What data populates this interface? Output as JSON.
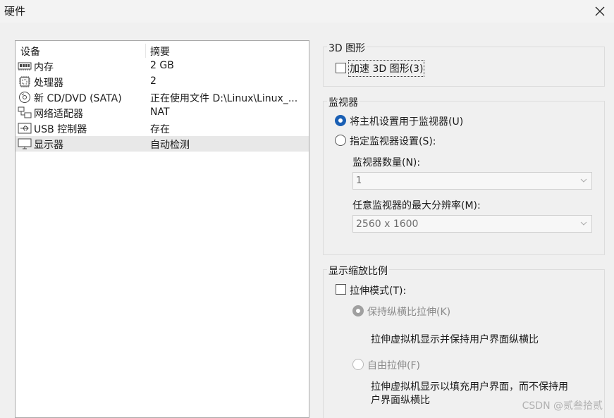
{
  "window": {
    "title": "硬件"
  },
  "device_list": {
    "headers": {
      "device": "设备",
      "summary": "摘要"
    },
    "rows": [
      {
        "name": "内存",
        "summary": "2 GB",
        "icon": "memory-icon"
      },
      {
        "name": "处理器",
        "summary": "2",
        "icon": "processor-icon"
      },
      {
        "name": "新 CD/DVD (SATA)",
        "summary": "正在使用文件 D:\\Linux\\Linux_...",
        "icon": "cd-dvd-icon"
      },
      {
        "name": "网络适配器",
        "summary": "NAT",
        "icon": "network-adapter-icon"
      },
      {
        "name": "USB 控制器",
        "summary": "存在",
        "icon": "usb-icon"
      },
      {
        "name": "显示器",
        "summary": "自动检测",
        "icon": "monitor-icon",
        "selected": true
      }
    ]
  },
  "graphics_3d": {
    "title": "3D 图形",
    "accelerate_label": "加速 3D 图形(3)",
    "accelerate_checked": false
  },
  "monitor": {
    "title": "监视器",
    "use_host_label": "将主机设置用于监视器(U)",
    "use_host_selected": true,
    "specify_label": "指定监视器设置(S):",
    "specify_selected": false,
    "count_label": "监视器数量(N):",
    "count_value": "1",
    "max_res_label": "任意监视器的最大分辨率(M):",
    "max_res_value": "2560 x 1600"
  },
  "display_scaling": {
    "title": "显示缩放比例",
    "stretch_label": "拉伸模式(T):",
    "stretch_checked": false,
    "keep_aspect_label": "保持纵横比拉伸(K)",
    "keep_aspect_desc": "拉伸虚拟机显示并保持用户界面纵横比",
    "free_stretch_label": "自由拉伸(F)",
    "free_stretch_desc_line1": "拉伸虚拟机显示以填充用户界面，而不保持用",
    "free_stretch_desc_line2": "户界面纵横比"
  },
  "watermark": "CSDN @贰叁拾贰",
  "colors": {
    "accent": "#1a5fb4",
    "selection": "#e8e8e8"
  }
}
